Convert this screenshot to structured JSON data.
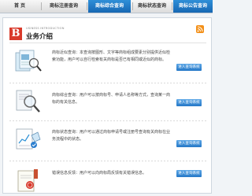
{
  "nav": {
    "items": [
      {
        "label": "首  页",
        "active": false
      },
      {
        "label": "商标注册查询",
        "active": false
      },
      {
        "label": "商标综合查询",
        "active": true
      },
      {
        "label": "商标状态查询",
        "active": false
      },
      {
        "label": "商标公告查询",
        "active": false
      }
    ]
  },
  "header": {
    "logo_letter": "B",
    "subtitle_en": "USINESS INTRODUCTION",
    "title": "业务介绍"
  },
  "services": [
    {
      "desc": "商标近似查询：本查询按图形、文字等商标组成要素分别提供近似检索功能，用户可以自行检索有关商标是否已有相同或近似的商标。",
      "button": "进入查询系统"
    },
    {
      "desc": "商标综合查询：用户可以按商标号、申请人名称等方式，查询某一商标的有关信息。",
      "button": "进入查询系统"
    },
    {
      "desc": "商标状态查询：用户可以通过商标申请号或注册号查询有关商标在业务流程中的状态。",
      "button": "进入查询系统"
    },
    {
      "desc": "错误信息反馈：用户可以向商标局反馈有关错误信息。",
      "button": "进入查询系统"
    }
  ],
  "colors": {
    "accent": "#1b6fbe",
    "logo": "#d93a2b",
    "rss": "#f39019"
  }
}
